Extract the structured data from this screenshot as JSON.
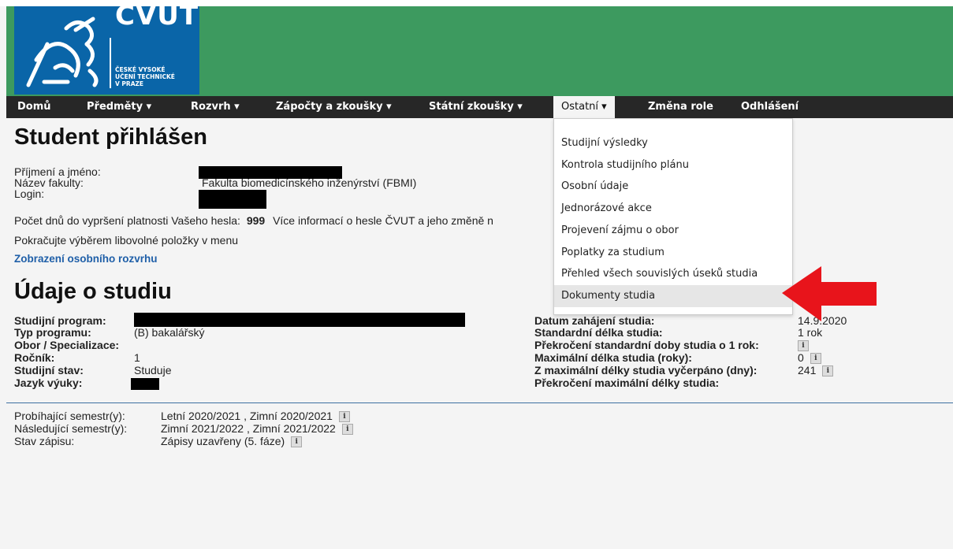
{
  "logo": {
    "brand": "ČVUT",
    "line1": "ČESKÉ VYSOKÉ",
    "line2": "UČENÍ TECHNICKÉ",
    "line3": "V PRAZE"
  },
  "nav": {
    "items": [
      "Domů",
      "Předměty ▾",
      "Rozvrh ▾",
      "Zápočty a zkoušky ▾",
      "Státní zkoušky ▾",
      "Ostatní ▾",
      "Změna role",
      "Odhlášení"
    ]
  },
  "dropdown": {
    "items": [
      "Studijní výsledky",
      "Kontrola studijního plánu",
      "Osobní údaje",
      "Jednorázové akce",
      "Projevení zájmu o obor",
      "Poplatky za studium",
      "Přehled všech souvislých úseků studia",
      "Dokumenty studia"
    ],
    "highlighted": "Dokumenty studia"
  },
  "student": {
    "title": "Student přihlášen",
    "name_label": "Příjmení a jméno:",
    "faculty_label": "Název fakulty:",
    "faculty_value": "Fakulta biomedicínského inženýrství (FBMI)",
    "login_label": "Login:",
    "password_days_label": "Počet dnů do vypršení platnosti Vašeho hesla:",
    "password_days_value": "999",
    "password_info": "Více informací o hesle ČVUT a jeho změně n",
    "continue_text": "Pokračujte výběrem libovolné položky v menu",
    "schedule_link": "Zobrazení osobního rozvrhu"
  },
  "study": {
    "title": "Údaje o studiu",
    "program_label": "Studijní program:",
    "type_label": "Typ programu:",
    "type_value": "(B) bakalářský",
    "field_label": "Obor / Specializace:",
    "year_label": "Ročník:",
    "year_value": "1",
    "status_label": "Studijní stav:",
    "status_value": "Studuje",
    "lang_label": "Jazyk výuky:",
    "start_label": "Datum zahájení studia:",
    "start_value": "14.9.2020",
    "std_len_label": "Standardní délka studia:",
    "std_len_value": "1 rok",
    "exceed_std_label": "Překročení standardní doby studia o 1 rok:",
    "max_len_label": "Maximální délka studia (roky):",
    "max_len_value": "0",
    "used_label": "Z maximální délky studia vyčerpáno (dny):",
    "used_value": "241",
    "exceed_max_label": "Překročení maximální délky studia:"
  },
  "semesters": {
    "current_label": "Probíhající semestr(y):",
    "current_value": "Letní 2020/2021 , Zimní 2020/2021",
    "next_label": "Následující semestr(y):",
    "next_value": "Zimní 2021/2022 , Zimní 2021/2022",
    "enroll_label": "Stav zápisu:",
    "enroll_value": "Zápisy uzavřeny (5. fáze)"
  },
  "info_icon": "i",
  "colors": {
    "header": "#3d9a5f",
    "logo": "#0a65a8",
    "nav": "#272727",
    "arrow": "#e8141b",
    "link": "#1f5fa8"
  }
}
